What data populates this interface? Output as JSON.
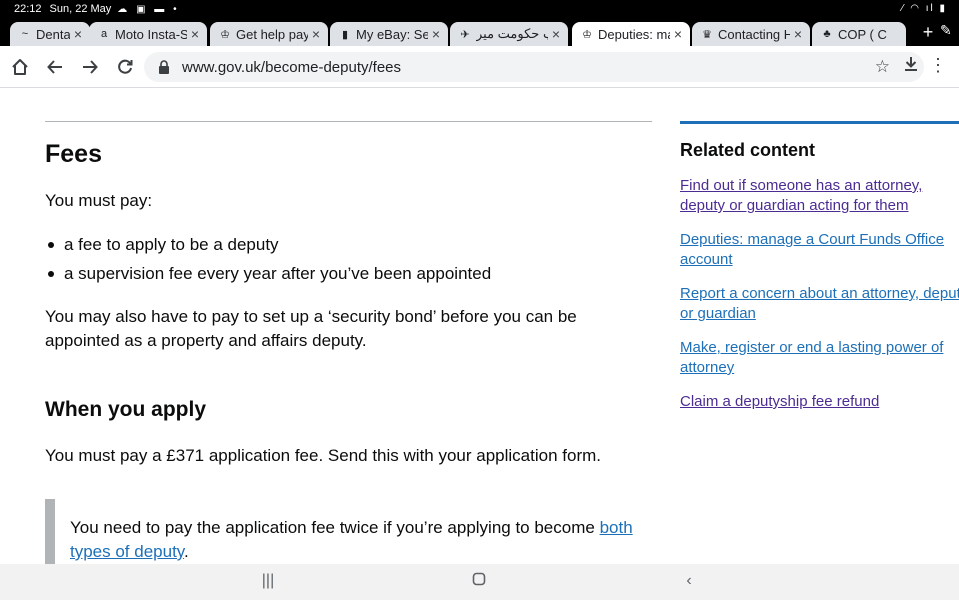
{
  "status_bar": {
    "time": "22:12",
    "date": "Sun, 22 May",
    "left_icons": "☁ ▣ ▬ •",
    "right_icons": "⁄ ◠ ıl ▮"
  },
  "tabs": [
    {
      "title": "Dental Ir",
      "favicon": "~",
      "favicon_name": "dental-favicon-icon",
      "active": false
    },
    {
      "title": "Moto Insta-S",
      "favicon": "a",
      "favicon_name": "amazon-favicon-icon",
      "active": false
    },
    {
      "title": "Get help pay",
      "favicon": "♔",
      "favicon_name": "gov-uk-favicon-icon",
      "active": false
    },
    {
      "title": "My eBay: Sel",
      "favicon": "▮",
      "favicon_name": "ebay-favicon-icon",
      "active": false
    },
    {
      "title": "آپ حکومت میر",
      "favicon": "✈",
      "favicon_name": "urdu-site-favicon-icon",
      "active": false
    },
    {
      "title": "Deputies: ma",
      "favicon": "♔",
      "favicon_name": "gov-uk-favicon-icon",
      "active": true
    },
    {
      "title": "Contacting H",
      "favicon": "♛",
      "favicon_name": "purple-crest-favicon-icon",
      "active": false
    },
    {
      "title": "COP ( C",
      "favicon": "♣",
      "favicon_name": "cop-favicon-icon",
      "active": false
    }
  ],
  "toolbar": {
    "url_host": "www.gov.uk",
    "url_path": "/become-deputy/fees"
  },
  "page": {
    "fees_heading": "Fees",
    "must_pay": "You must pay:",
    "bullets": [
      "a fee to apply to be a deputy",
      "a supervision fee every year after you’ve been appointed"
    ],
    "security_bond_para": "You may also have to pay to set up a ‘security bond’ before you can be appointed as a property and affairs deputy.",
    "when_apply_heading": "When you apply",
    "application_fee_para": "You must pay a £371 application fee. Send this with your application form.",
    "inset_text_before": "You need to pay the application fee twice if you’re applying to become ",
    "inset_link": "both types of deputy",
    "inset_text_after": "."
  },
  "related": {
    "title": "Related content",
    "links": [
      {
        "label": "Find out if someone has an attorney, deputy or guardian acting for them",
        "visited": true
      },
      {
        "label": "Deputies: manage a Court Funds Office account",
        "visited": false
      },
      {
        "label": "Report a concern about an attorney, deputy or guardian",
        "visited": false
      },
      {
        "label": "Make, register or end a lasting power of attorney",
        "visited": false
      },
      {
        "label": "Claim a deputyship fee refund",
        "visited": true
      }
    ]
  },
  "colors": {
    "link": "#1d70b8",
    "visited": "#4c2c92",
    "text": "#0b0c0c",
    "inset_border": "#b1b4b6"
  }
}
